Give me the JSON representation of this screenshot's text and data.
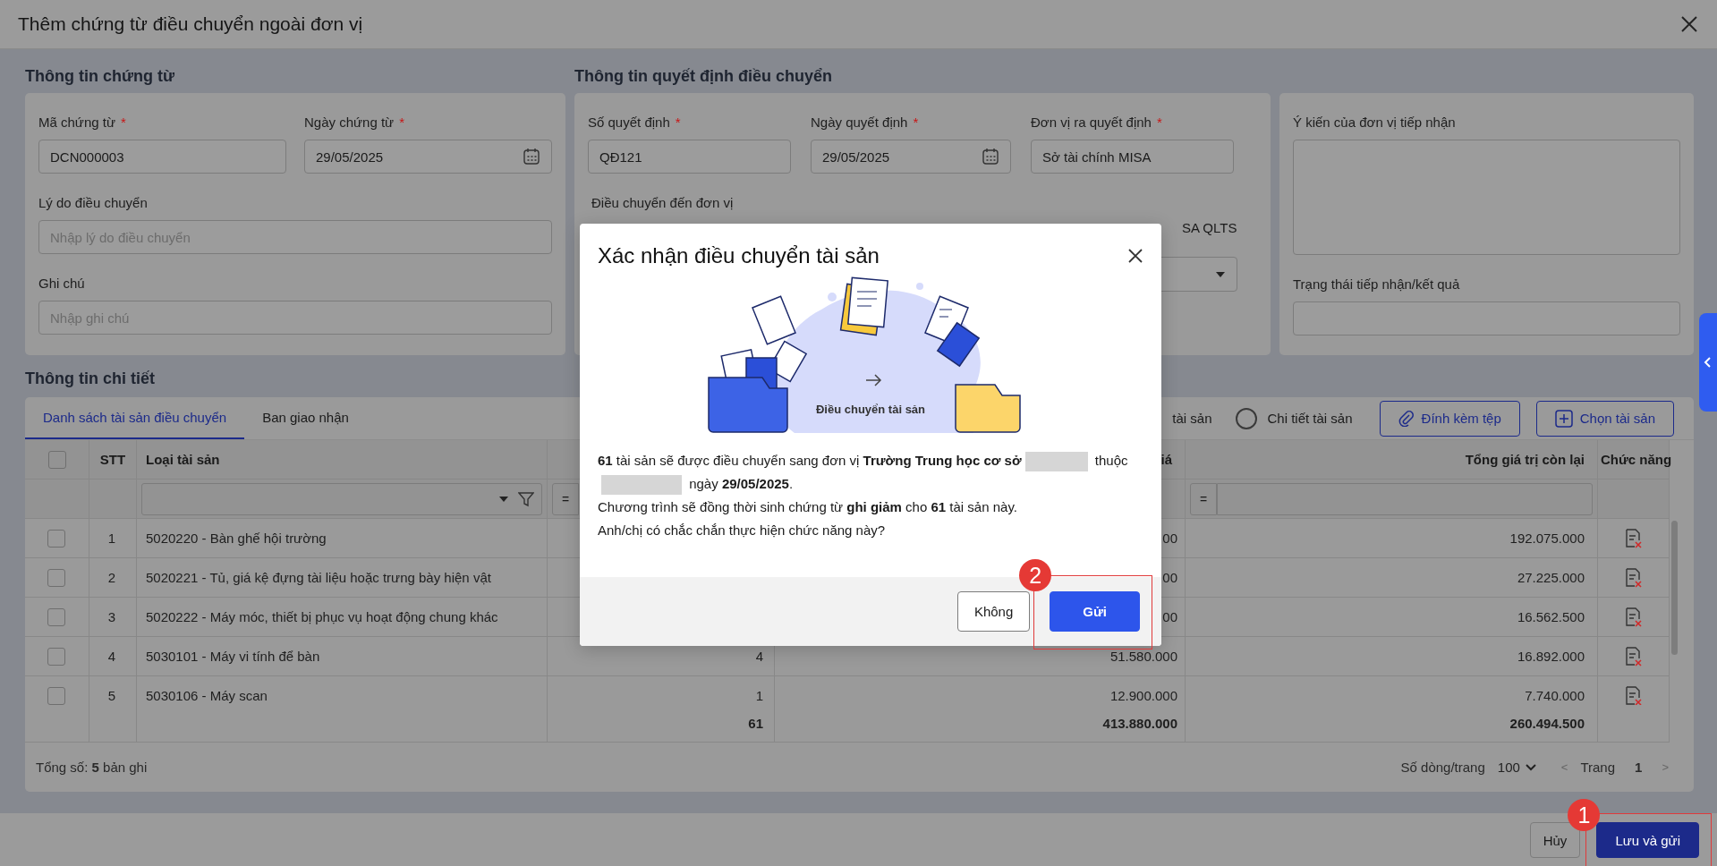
{
  "window": {
    "title": "Thêm chứng từ điều chuyển ngoài đơn vị"
  },
  "voucher_info": {
    "heading": "Thông tin chứng từ",
    "fields": [
      {
        "label": "Mã chứng từ",
        "required_mark": "*",
        "value": "DCN000003",
        "kind": "text"
      },
      {
        "label": "Ngày chứng từ",
        "required_mark": "*",
        "value": "29/05/2025",
        "kind": "date"
      },
      {
        "label": "Lý do điều chuyển",
        "placeholder": "Nhập lý do điều chuyển",
        "kind": "text"
      },
      {
        "label": "Ghi chú",
        "placeholder": "Nhập ghi chú",
        "kind": "text"
      }
    ]
  },
  "decision_info": {
    "heading": "Thông tin quyết định điều chuyển",
    "fields": [
      {
        "label": "Số quyết định",
        "required_mark": "*",
        "value": "QĐ121",
        "kind": "text"
      },
      {
        "label": "Ngày quyết định",
        "required_mark": "*",
        "value": "29/05/2025",
        "kind": "date"
      },
      {
        "label": "Đơn vị ra quyết định",
        "required_mark": "*",
        "value": "Sở tài chính MISA",
        "kind": "text"
      }
    ],
    "destination_label": "Điều chuyển đến đơn vị",
    "destination_fragment": "SA QLTS"
  },
  "receiver_info": {
    "opinion_label": "Ý kiến của đơn vị tiếp nhận",
    "status_label": "Trạng thái tiếp nhận/kết quả"
  },
  "detail": {
    "heading": "Thông tin chi tiết",
    "tabs": [
      {
        "label": "Danh sách tài sản điều chuyển",
        "selected": true
      },
      {
        "label": "Ban giao nhận",
        "selected": false
      }
    ],
    "radio_fragment": "tài sản",
    "detail_radio": {
      "label": "Chi tiết tài sản",
      "selected": false
    },
    "buttons": [
      {
        "label": "Đính kèm tệp",
        "kind": "attach"
      },
      {
        "label": "Chọn tài sản",
        "kind": "add"
      }
    ],
    "table": {
      "header_checked": false,
      "columns": [
        "STT",
        "Loại tài sản",
        "iá",
        "Tổng giá trị còn lại",
        "Chức năng"
      ],
      "rows": [
        {
          "checked": false,
          "stt": "1",
          "asset_type": "5020220 - Bàn ghế hội trường",
          "column_5": "00",
          "remaining": "192.075.000"
        },
        {
          "checked": false,
          "stt": "2",
          "asset_type": "5020221 - Tủ, giá kệ đựng tài liệu hoặc trưng bày hiện vật",
          "column_5": "00",
          "remaining": "27.225.000"
        },
        {
          "checked": false,
          "stt": "3",
          "asset_type": "5020222 - Máy móc, thiết bị phục vụ hoạt động chung khác",
          "column_5": "00",
          "remaining": "16.562.500"
        },
        {
          "checked": false,
          "stt": "4",
          "asset_type": "5030101 - Máy vi tính để bàn",
          "column_4": "4",
          "column_5": "51.580.000",
          "remaining": "16.892.000"
        },
        {
          "checked": false,
          "stt": "5",
          "asset_type": "5030106 - Máy scan",
          "column_4": "1",
          "column_5": "12.900.000",
          "remaining": "7.740.000"
        }
      ],
      "totals": {
        "column_4": "61",
        "column_5": "413.880.000",
        "remaining": "260.494.500"
      },
      "filter_operators": [
        "=",
        "="
      ]
    },
    "summary": "Tổng số: **5** bản ghi",
    "page_size_label": "Số dòng/trang",
    "page_size": "100",
    "page_label": "Trang",
    "page": "1",
    "prev": "<",
    "next": ">"
  },
  "footer": {
    "buttons": [
      {
        "label": "Hủy",
        "kind": "secondary"
      },
      {
        "label": "Lưu và gửi",
        "kind": "primary"
      }
    ]
  },
  "dialog": {
    "title": "Xác nhận điều chuyển tài sản",
    "illustration_caption": "Điều chuyển tài sản",
    "message": [
      {
        "parts": [
          {
            "kind": "text",
            "text": "**61** tài sản sẽ được điều chuyển sang đơn vị **Trường Trung học cơ sở**"
          },
          {
            "kind": "redacted"
          },
          {
            "kind": "text",
            "text": "thuộc"
          },
          {
            "kind": "redacted"
          },
          {
            "kind": "text",
            "text": "ngày **29/05/2025**."
          }
        ]
      },
      {
        "parts": [
          {
            "kind": "text",
            "text": "Chương trình sẽ đồng thời sinh chứng từ **ghi giảm** cho **61** tài sản này."
          }
        ]
      },
      {
        "parts": [
          {
            "kind": "text",
            "text": "Anh/chị có chắc chắn thực hiện chức năng này?"
          }
        ]
      }
    ],
    "buttons": [
      {
        "label": "Không",
        "kind": "secondary"
      },
      {
        "label": "Gửi",
        "kind": "primary"
      }
    ]
  },
  "annotations": [
    {
      "number": "1"
    },
    {
      "number": "2"
    }
  ]
}
